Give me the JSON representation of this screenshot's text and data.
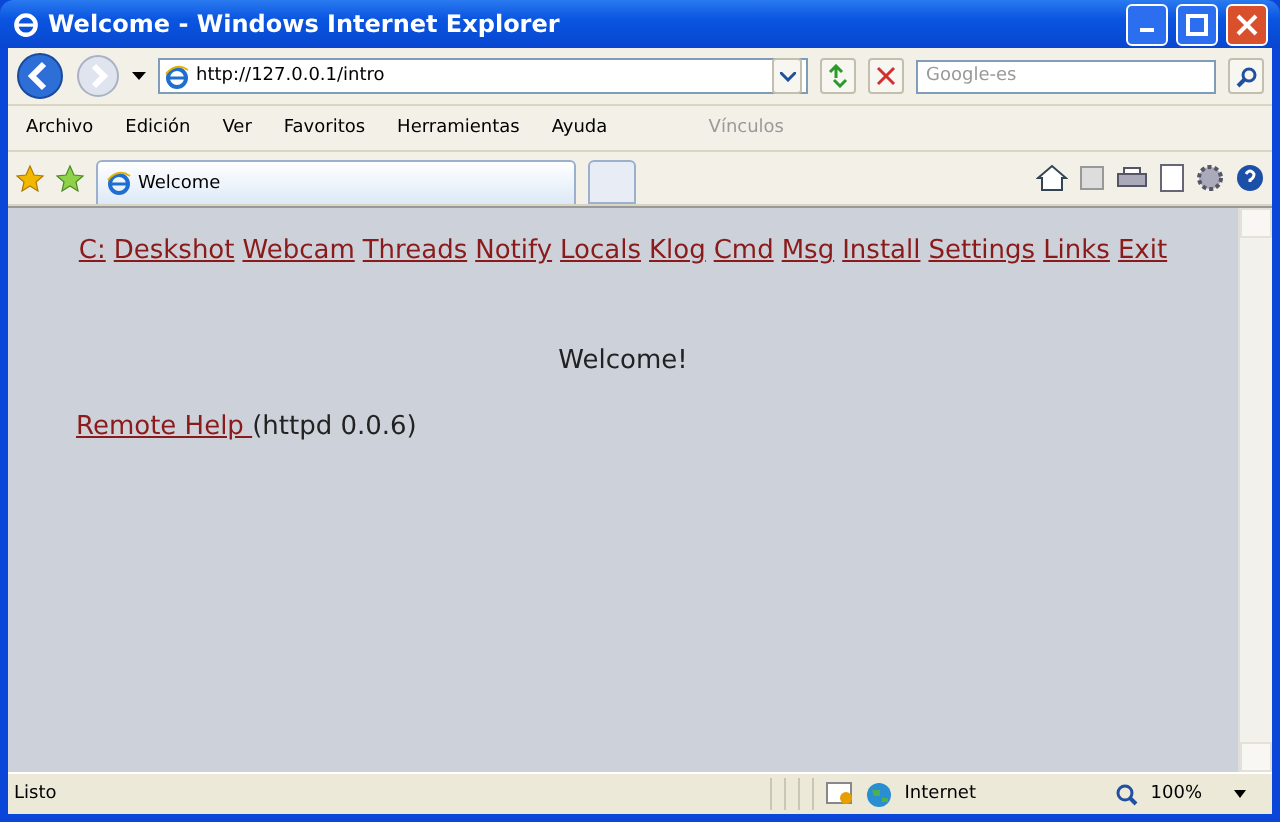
{
  "window": {
    "title": "Welcome - Windows Internet Explorer"
  },
  "address": {
    "value": "http://127.0.0.1/intro"
  },
  "search": {
    "placeholder": "Google-es"
  },
  "menu": [
    "Archivo",
    "Edición",
    "Ver",
    "Favoritos",
    "Herramientas",
    "Ayuda"
  ],
  "links_bar": {
    "label": "Vínculos"
  },
  "tabs": [
    {
      "label": "Welcome",
      "selected": true
    }
  ],
  "page": {
    "nav": [
      "C:",
      "Deskshot",
      "Webcam",
      "Threads",
      "Notify",
      "Locals",
      "Klog",
      "Cmd",
      "Msg",
      "Install",
      "Settings",
      "Links",
      "Exit"
    ],
    "heading": "Welcome!",
    "footer_link": "Remote Help ",
    "footer_text": "(httpd 0.0.6)"
  },
  "status_bar": {
    "text": "Listo",
    "zone": "Internet",
    "zoom": "100%"
  }
}
